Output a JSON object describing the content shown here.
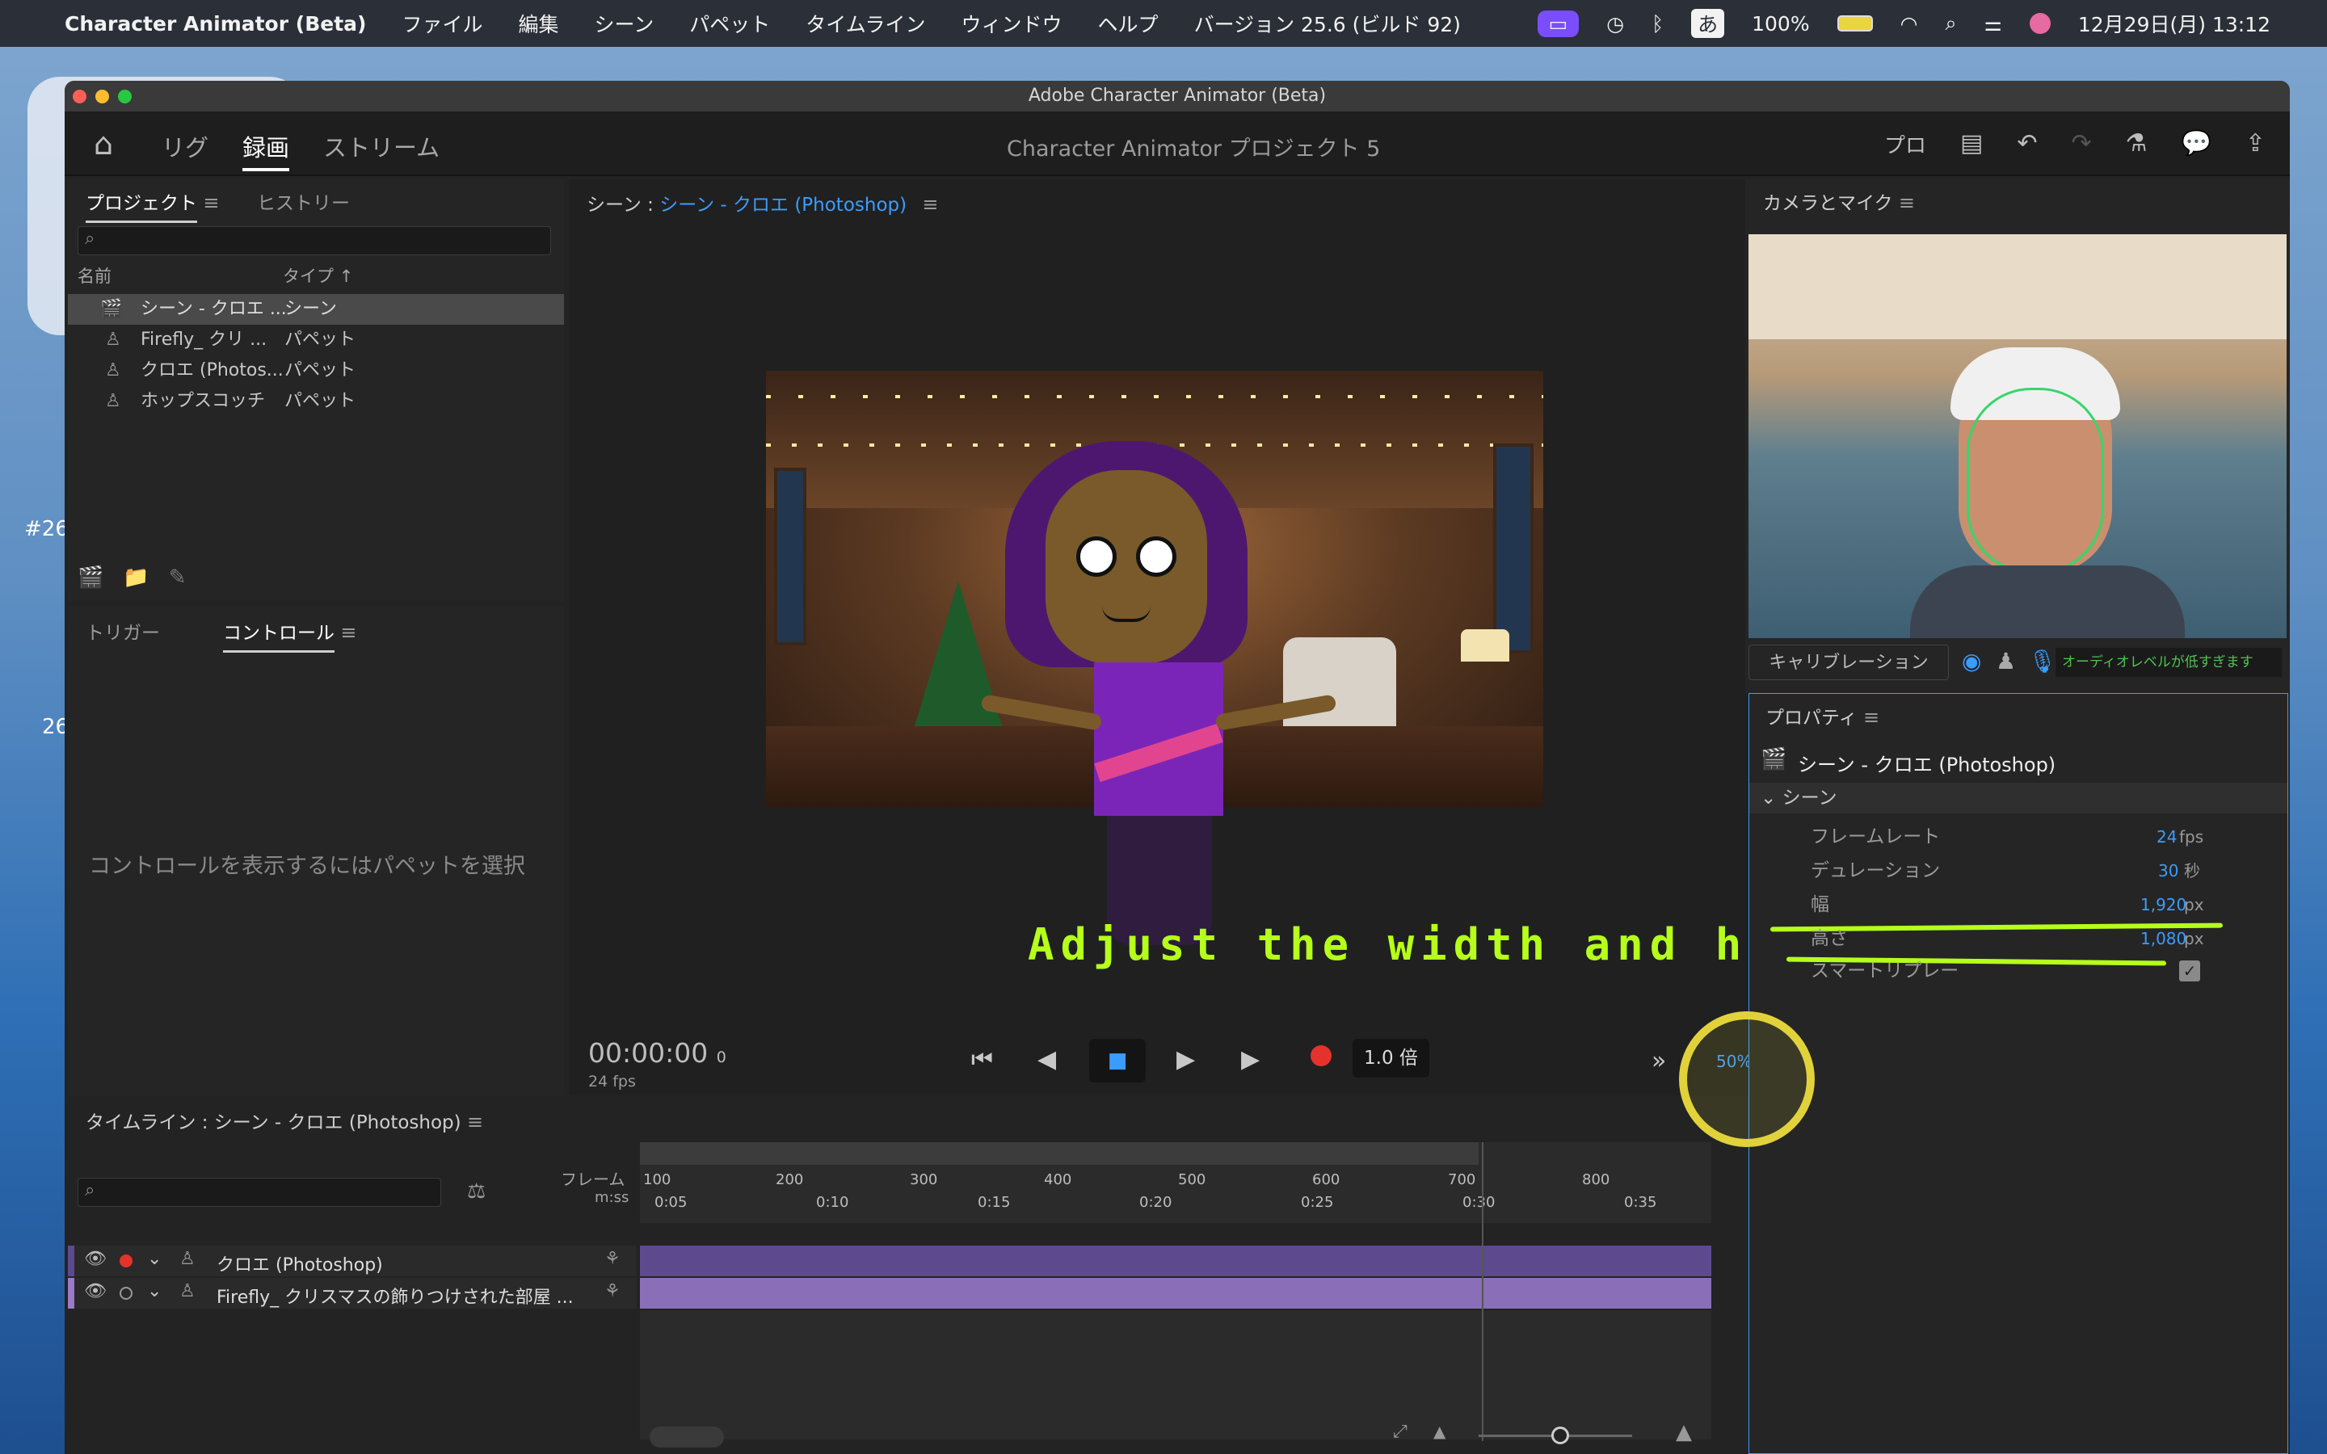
{
  "menubar": {
    "app": "Character Animator (Beta)",
    "items": [
      "ファイル",
      "編集",
      "シーン",
      "パペット",
      "タイムライン",
      "ウィンドウ",
      "ヘルプ",
      "バージョン 25.6 (ビルド 92)"
    ],
    "input_mode": "あ",
    "battery": "100%",
    "datetime": "12月29日(月) 13:12"
  },
  "window": {
    "title": "Adobe Character Animator (Beta)"
  },
  "appbar": {
    "modes": [
      "リグ",
      "録画",
      "ストリーム"
    ],
    "project_title": "Character Animator プロジェクト 5",
    "pro_label": "プロ"
  },
  "project_panel": {
    "tabs": [
      "プロジェクト",
      "ヒストリー"
    ],
    "search_placeholder": "",
    "col_name": "名前",
    "col_type": "タイプ",
    "items": [
      {
        "name": "シーン - クロエ ...",
        "type": "シーン"
      },
      {
        "name": "Firefly_ クリ ...",
        "type": "パペット"
      },
      {
        "name": "クロエ (Photos...",
        "type": "パペット"
      },
      {
        "name": "ホップスコッチ",
        "type": "パペット"
      }
    ]
  },
  "controls_panel": {
    "tabs": [
      "トリガー",
      "コントロール"
    ],
    "empty_message": "コントロールを表示するにはパペットを選択"
  },
  "scene_panel": {
    "label": "シーン :",
    "scene_name": "シーン - クロエ (Photoshop)",
    "timecode": "00:00:00",
    "frame": "0",
    "fps": "24 fps",
    "speed": "1.0 倍",
    "zoom": "50%",
    "overlay_caption": "Adjust the width and height."
  },
  "camera_panel": {
    "title": "カメラとマイク",
    "calibrate": "キャリブレーション",
    "audio_msg": "オーディオレベルが低すぎます"
  },
  "properties_panel": {
    "title": "プロパティ",
    "scene_name": "シーン - クロエ (Photoshop)",
    "section": "シーン",
    "rows": [
      {
        "label": "フレームレート",
        "value": "24",
        "unit": "fps"
      },
      {
        "label": "デュレーション",
        "value": "30",
        "unit": "秒"
      },
      {
        "label": "幅",
        "value": "1,920",
        "unit": "px"
      },
      {
        "label": "高さ",
        "value": "1,080",
        "unit": "px"
      },
      {
        "label": "スマートリプレー",
        "value": "",
        "unit": ""
      }
    ]
  },
  "timeline": {
    "title": "タイムライン : シーン - クロエ (Photoshop)",
    "frame_label": "フレーム",
    "time_label": "m:ss",
    "frame_ticks": [
      "100",
      "200",
      "300",
      "400",
      "500",
      "600",
      "700",
      "800"
    ],
    "time_ticks": [
      "0:05",
      "0:10",
      "0:15",
      "0:20",
      "0:25",
      "0:30",
      "0:35"
    ],
    "tracks": [
      {
        "name": "クロエ (Photoshop)"
      },
      {
        "name": "Firefly_ クリスマスの飾りつけされた部屋 ..."
      }
    ]
  },
  "colors": {
    "accent": "#3b9cff",
    "annotation": "#b5ff1a",
    "track": "#5d4a8e",
    "record": "#e5322d"
  }
}
